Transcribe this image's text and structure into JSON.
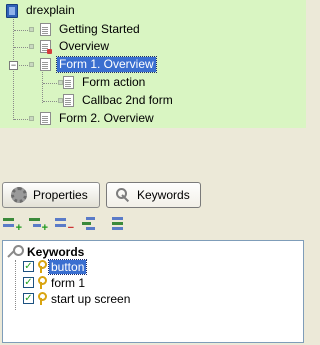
{
  "tree": {
    "root": {
      "label": "drexplain",
      "icon": "book-icon"
    },
    "items": [
      {
        "label": "Getting Started",
        "icon": "page-icon",
        "selected": false
      },
      {
        "label": "Overview",
        "icon": "page-red-icon",
        "selected": false
      },
      {
        "label": "Form 1. Overview",
        "icon": "page-icon",
        "selected": true,
        "expanded": true
      },
      {
        "label": "Form action",
        "icon": "page-icon",
        "selected": false
      },
      {
        "label": "Callbac 2nd form",
        "icon": "page-icon",
        "selected": false
      },
      {
        "label": "Form 2. Overview",
        "icon": "page-icon",
        "selected": false
      }
    ],
    "colors": {
      "background": "#d9f5c2",
      "selection": "#3a6fd0"
    }
  },
  "tabs": {
    "properties": {
      "label": "Properties",
      "icon": "gear-icon",
      "active": false
    },
    "keywords": {
      "label": "Keywords",
      "icon": "key-icon",
      "active": true
    }
  },
  "toolbar": {
    "buttons": [
      {
        "name": "add-keyword-button",
        "icon": "add-icon"
      },
      {
        "name": "add-child-keyword-button",
        "icon": "add-child-icon"
      },
      {
        "name": "remove-keyword-button",
        "icon": "remove-icon"
      },
      {
        "name": "sort-button",
        "icon": "sort-icon"
      },
      {
        "name": "list-button",
        "icon": "list-icon"
      }
    ]
  },
  "keywords": {
    "root_label": "Keywords",
    "items": [
      {
        "label": "button",
        "checked": true,
        "selected": true
      },
      {
        "label": "form 1",
        "checked": true,
        "selected": false
      },
      {
        "label": "start up screen",
        "checked": true,
        "selected": false
      }
    ]
  }
}
